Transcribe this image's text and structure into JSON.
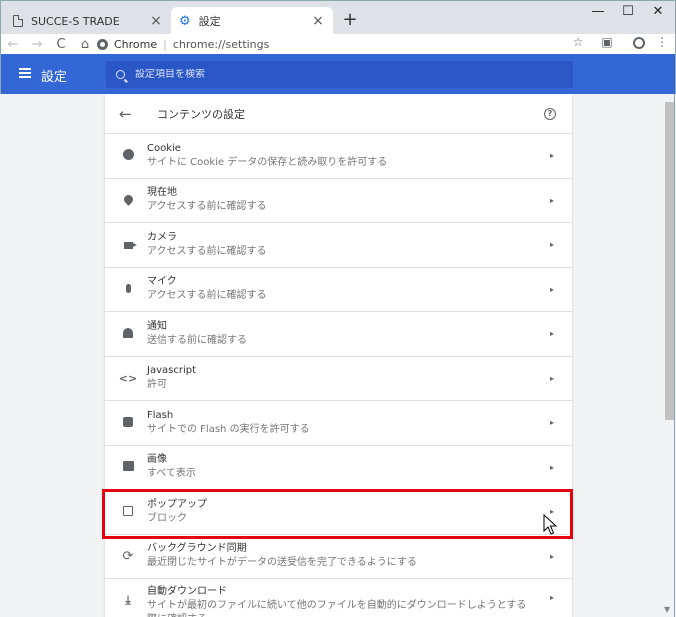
{
  "tabs": [
    {
      "title": "SUCCE-S TRADE",
      "close": "×"
    },
    {
      "title": "設定",
      "close": "×"
    }
  ],
  "window_controls": {
    "minimize": "—",
    "maximize": "☐",
    "close": "✕",
    "new_tab": "+"
  },
  "toolbar": {
    "back": "←",
    "forward": "→",
    "reload": "C",
    "home": "⌂",
    "site_name": "Chrome",
    "url": "chrome://settings",
    "star": "☆",
    "camera": "▣",
    "more": "⋮"
  },
  "header": {
    "title": "設定",
    "search_placeholder": "設定項目を検索",
    "color": "#3367d6"
  },
  "card": {
    "title": "コンテンツの設定",
    "help": "?"
  },
  "rows": [
    {
      "icon": "cookie-icon",
      "title": "Cookie",
      "sub": "サイトに Cookie データの保存と読み取りを許可する"
    },
    {
      "icon": "location-icon",
      "title": "現在地",
      "sub": "アクセスする前に確認する"
    },
    {
      "icon": "camera-icon",
      "title": "カメラ",
      "sub": "アクセスする前に確認する"
    },
    {
      "icon": "mic-icon",
      "title": "マイク",
      "sub": "アクセスする前に確認する"
    },
    {
      "icon": "bell-icon",
      "title": "通知",
      "sub": "送信する前に確認する"
    },
    {
      "icon": "code-icon",
      "title": "Javascript",
      "sub": "許可"
    },
    {
      "icon": "puzzle-icon",
      "title": "Flash",
      "sub": "サイトでの Flash の実行を許可する"
    },
    {
      "icon": "image-icon",
      "title": "画像",
      "sub": "すべて表示"
    },
    {
      "icon": "popup-icon",
      "title": "ポップアップ",
      "sub": "ブロック"
    },
    {
      "icon": "sync-icon",
      "title": "バックグラウンド同期",
      "sub": "最近閉じたサイトがデータの送受信を完了できるようにする"
    },
    {
      "icon": "download-icon",
      "title": "自動ダウンロード",
      "sub": "サイトが最初のファイルに続いて他のファイルを自動的にダウンロードしようとする際に確認する"
    }
  ],
  "row_arrow": "▸",
  "highlight_color": "#e60012"
}
